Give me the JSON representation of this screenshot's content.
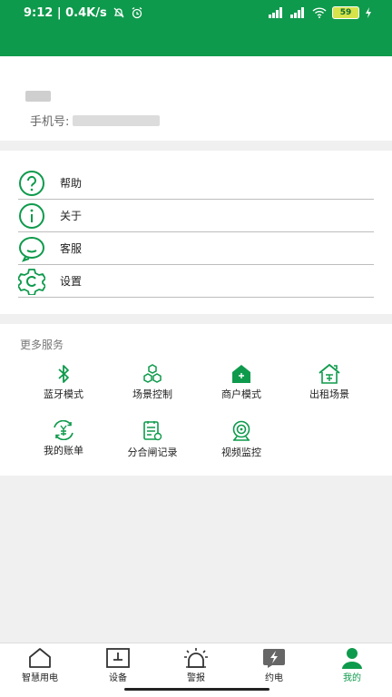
{
  "status_bar": {
    "time_speed": "9:12 | 0.4K/s",
    "battery": "59",
    "accent": "#0e9a4c"
  },
  "profile": {
    "phone_label": "手机号:"
  },
  "menu": {
    "items": [
      {
        "label": "帮助",
        "icon": "question-icon"
      },
      {
        "label": "关于",
        "icon": "info-icon"
      },
      {
        "label": "客服",
        "icon": "chat-icon"
      },
      {
        "label": "设置",
        "icon": "gear-icon"
      }
    ]
  },
  "services": {
    "title": "更多服务",
    "items": [
      {
        "label": "蓝牙模式",
        "icon": "bluetooth-icon"
      },
      {
        "label": "场景控制",
        "icon": "hexagons-icon"
      },
      {
        "label": "商户模式",
        "icon": "shop-icon"
      },
      {
        "label": "出租场景",
        "icon": "rental-house-icon"
      },
      {
        "label": "我的账单",
        "icon": "bill-icon"
      },
      {
        "label": "分合闸记录",
        "icon": "record-icon"
      },
      {
        "label": "视频监控",
        "icon": "camera-icon"
      }
    ]
  },
  "tabbar": {
    "tabs": [
      {
        "label": "智慧用电",
        "icon": "home-icon"
      },
      {
        "label": "设备",
        "icon": "device-icon"
      },
      {
        "label": "警报",
        "icon": "alarm-icon"
      },
      {
        "label": "约电",
        "icon": "lightning-icon"
      },
      {
        "label": "我的",
        "icon": "user-icon",
        "active": true
      }
    ]
  }
}
